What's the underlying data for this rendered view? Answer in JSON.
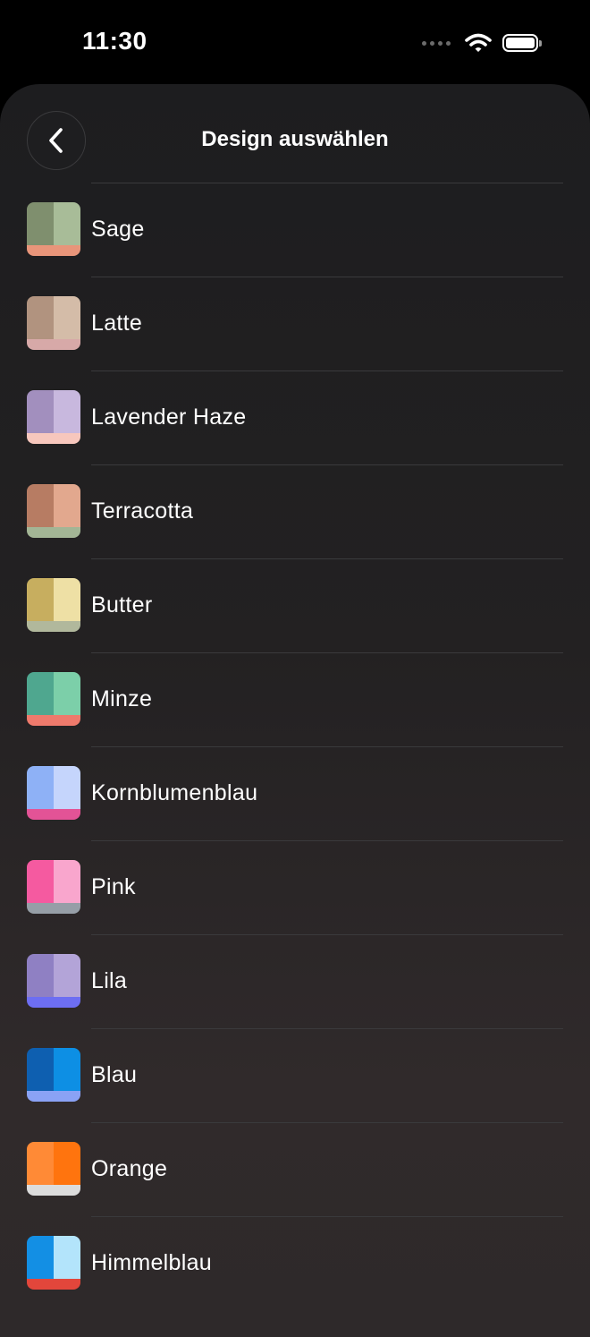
{
  "status_bar": {
    "time": "11:30"
  },
  "nav": {
    "title": "Design auswählen",
    "back_icon": "chevron-left-icon"
  },
  "themes": [
    {
      "label": "Sage",
      "colors": [
        "#7f8f6e",
        "#a8bc98",
        "#e8957a"
      ]
    },
    {
      "label": "Latte",
      "colors": [
        "#b1937f",
        "#d4bca8",
        "#d7a9a8"
      ]
    },
    {
      "label": "Lavender Haze",
      "colors": [
        "#a28fbe",
        "#c8b8de",
        "#f7c7bd"
      ]
    },
    {
      "label": "Terracotta",
      "colors": [
        "#b77c63",
        "#e2a88e",
        "#a3b595"
      ]
    },
    {
      "label": "Butter",
      "colors": [
        "#c7ae5f",
        "#eee0a5",
        "#b1b89c"
      ]
    },
    {
      "label": "Minze",
      "colors": [
        "#4fa78f",
        "#7ccfa9",
        "#ee7a6c"
      ]
    },
    {
      "label": "Kornblumenblau",
      "colors": [
        "#8eb1f6",
        "#c5d5fc",
        "#e35396"
      ]
    },
    {
      "label": "Pink",
      "colors": [
        "#f55aa0",
        "#f9a6cd",
        "#969ea7"
      ]
    },
    {
      "label": "Lila",
      "colors": [
        "#8f80c3",
        "#b3a4d8",
        "#6d6ef2"
      ]
    },
    {
      "label": "Blau",
      "colors": [
        "#0e5fb0",
        "#0d8fe4",
        "#8aa2f5"
      ]
    },
    {
      "label": "Orange",
      "colors": [
        "#ff8a36",
        "#ff740e",
        "#dcdcdc"
      ]
    },
    {
      "label": "Himmelblau",
      "colors": [
        "#138fe4",
        "#b3e4fb",
        "#e2463b"
      ]
    }
  ]
}
